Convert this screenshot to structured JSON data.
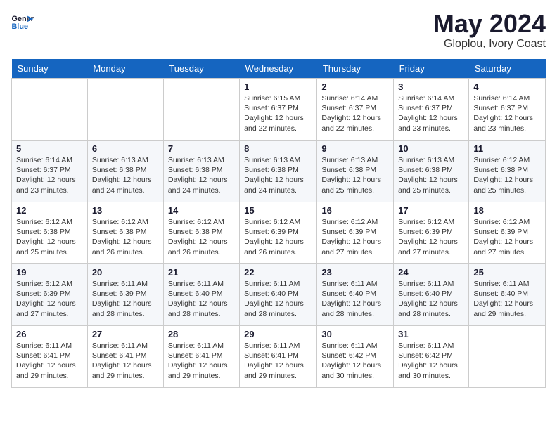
{
  "header": {
    "logo_line1": "General",
    "logo_line2": "Blue",
    "month": "May 2024",
    "location": "Gloplou, Ivory Coast"
  },
  "days_of_week": [
    "Sunday",
    "Monday",
    "Tuesday",
    "Wednesday",
    "Thursday",
    "Friday",
    "Saturday"
  ],
  "weeks": [
    [
      {
        "day": "",
        "info": ""
      },
      {
        "day": "",
        "info": ""
      },
      {
        "day": "",
        "info": ""
      },
      {
        "day": "1",
        "info": "Sunrise: 6:15 AM\nSunset: 6:37 PM\nDaylight: 12 hours\nand 22 minutes."
      },
      {
        "day": "2",
        "info": "Sunrise: 6:14 AM\nSunset: 6:37 PM\nDaylight: 12 hours\nand 22 minutes."
      },
      {
        "day": "3",
        "info": "Sunrise: 6:14 AM\nSunset: 6:37 PM\nDaylight: 12 hours\nand 23 minutes."
      },
      {
        "day": "4",
        "info": "Sunrise: 6:14 AM\nSunset: 6:37 PM\nDaylight: 12 hours\nand 23 minutes."
      }
    ],
    [
      {
        "day": "5",
        "info": "Sunrise: 6:14 AM\nSunset: 6:37 PM\nDaylight: 12 hours\nand 23 minutes."
      },
      {
        "day": "6",
        "info": "Sunrise: 6:13 AM\nSunset: 6:38 PM\nDaylight: 12 hours\nand 24 minutes."
      },
      {
        "day": "7",
        "info": "Sunrise: 6:13 AM\nSunset: 6:38 PM\nDaylight: 12 hours\nand 24 minutes."
      },
      {
        "day": "8",
        "info": "Sunrise: 6:13 AM\nSunset: 6:38 PM\nDaylight: 12 hours\nand 24 minutes."
      },
      {
        "day": "9",
        "info": "Sunrise: 6:13 AM\nSunset: 6:38 PM\nDaylight: 12 hours\nand 25 minutes."
      },
      {
        "day": "10",
        "info": "Sunrise: 6:13 AM\nSunset: 6:38 PM\nDaylight: 12 hours\nand 25 minutes."
      },
      {
        "day": "11",
        "info": "Sunrise: 6:12 AM\nSunset: 6:38 PM\nDaylight: 12 hours\nand 25 minutes."
      }
    ],
    [
      {
        "day": "12",
        "info": "Sunrise: 6:12 AM\nSunset: 6:38 PM\nDaylight: 12 hours\nand 25 minutes."
      },
      {
        "day": "13",
        "info": "Sunrise: 6:12 AM\nSunset: 6:38 PM\nDaylight: 12 hours\nand 26 minutes."
      },
      {
        "day": "14",
        "info": "Sunrise: 6:12 AM\nSunset: 6:38 PM\nDaylight: 12 hours\nand 26 minutes."
      },
      {
        "day": "15",
        "info": "Sunrise: 6:12 AM\nSunset: 6:39 PM\nDaylight: 12 hours\nand 26 minutes."
      },
      {
        "day": "16",
        "info": "Sunrise: 6:12 AM\nSunset: 6:39 PM\nDaylight: 12 hours\nand 27 minutes."
      },
      {
        "day": "17",
        "info": "Sunrise: 6:12 AM\nSunset: 6:39 PM\nDaylight: 12 hours\nand 27 minutes."
      },
      {
        "day": "18",
        "info": "Sunrise: 6:12 AM\nSunset: 6:39 PM\nDaylight: 12 hours\nand 27 minutes."
      }
    ],
    [
      {
        "day": "19",
        "info": "Sunrise: 6:12 AM\nSunset: 6:39 PM\nDaylight: 12 hours\nand 27 minutes."
      },
      {
        "day": "20",
        "info": "Sunrise: 6:11 AM\nSunset: 6:39 PM\nDaylight: 12 hours\nand 28 minutes."
      },
      {
        "day": "21",
        "info": "Sunrise: 6:11 AM\nSunset: 6:40 PM\nDaylight: 12 hours\nand 28 minutes."
      },
      {
        "day": "22",
        "info": "Sunrise: 6:11 AM\nSunset: 6:40 PM\nDaylight: 12 hours\nand 28 minutes."
      },
      {
        "day": "23",
        "info": "Sunrise: 6:11 AM\nSunset: 6:40 PM\nDaylight: 12 hours\nand 28 minutes."
      },
      {
        "day": "24",
        "info": "Sunrise: 6:11 AM\nSunset: 6:40 PM\nDaylight: 12 hours\nand 28 minutes."
      },
      {
        "day": "25",
        "info": "Sunrise: 6:11 AM\nSunset: 6:40 PM\nDaylight: 12 hours\nand 29 minutes."
      }
    ],
    [
      {
        "day": "26",
        "info": "Sunrise: 6:11 AM\nSunset: 6:41 PM\nDaylight: 12 hours\nand 29 minutes."
      },
      {
        "day": "27",
        "info": "Sunrise: 6:11 AM\nSunset: 6:41 PM\nDaylight: 12 hours\nand 29 minutes."
      },
      {
        "day": "28",
        "info": "Sunrise: 6:11 AM\nSunset: 6:41 PM\nDaylight: 12 hours\nand 29 minutes."
      },
      {
        "day": "29",
        "info": "Sunrise: 6:11 AM\nSunset: 6:41 PM\nDaylight: 12 hours\nand 29 minutes."
      },
      {
        "day": "30",
        "info": "Sunrise: 6:11 AM\nSunset: 6:42 PM\nDaylight: 12 hours\nand 30 minutes."
      },
      {
        "day": "31",
        "info": "Sunrise: 6:11 AM\nSunset: 6:42 PM\nDaylight: 12 hours\nand 30 minutes."
      },
      {
        "day": "",
        "info": ""
      }
    ]
  ]
}
